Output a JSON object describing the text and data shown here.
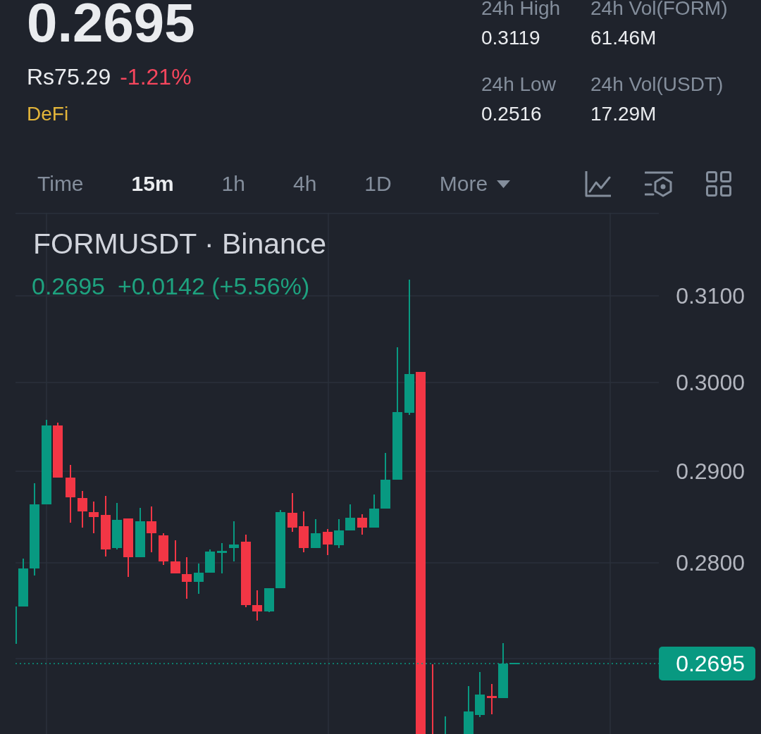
{
  "header": {
    "price": "0.2695",
    "fiat_price": "Rs75.29",
    "change": "-1.21%",
    "rising": false,
    "tag": "DeFi"
  },
  "stats": [
    {
      "label": "24h High",
      "value": "0.3119"
    },
    {
      "label": "24h Vol(FORM)",
      "value": "61.46M"
    },
    {
      "label": "24h Low",
      "value": "0.2516"
    },
    {
      "label": "24h Vol(USDT)",
      "value": "17.29M"
    }
  ],
  "interval_tabs": [
    {
      "label": "Time",
      "selected": false
    },
    {
      "label": "15m",
      "selected": true
    },
    {
      "label": "1h",
      "selected": false
    },
    {
      "label": "4h",
      "selected": false
    },
    {
      "label": "1D",
      "selected": false
    }
  ],
  "more_menu": {
    "label": "More"
  },
  "chart": {
    "title": "FORMUSDT · Binance",
    "legend": {
      "price": "0.2695",
      "change": "+0.0142 (+5.56%)",
      "rising": true
    },
    "price_axis": [
      "0.3100",
      "0.3000",
      "0.2900",
      "0.2800"
    ],
    "last_price": "0.2695"
  }
}
